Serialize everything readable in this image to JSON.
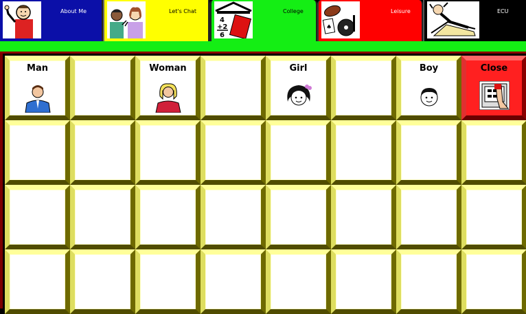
{
  "tabs": [
    {
      "label": "About Me",
      "icon": "waving-man-icon"
    },
    {
      "label": "Let's Chat",
      "icon": "two-people-chatting-icon"
    },
    {
      "label": "College",
      "icon": "college-math-book-icon"
    },
    {
      "label": "Leisure",
      "icon": "football-cards-music-icon"
    },
    {
      "label": "ECU",
      "icon": "relaxing-person-icon"
    }
  ],
  "grid": {
    "row1": [
      "Man",
      "",
      "Woman",
      "",
      "Girl",
      "",
      "Boy",
      "Close"
    ]
  },
  "colors": {
    "about": "#0b0fa8",
    "chat": "#ffff00",
    "college": "#14ee14",
    "leisure": "#ff0000",
    "ecu": "#000000",
    "cell": "#ffffc9",
    "close": "#ff2020"
  }
}
